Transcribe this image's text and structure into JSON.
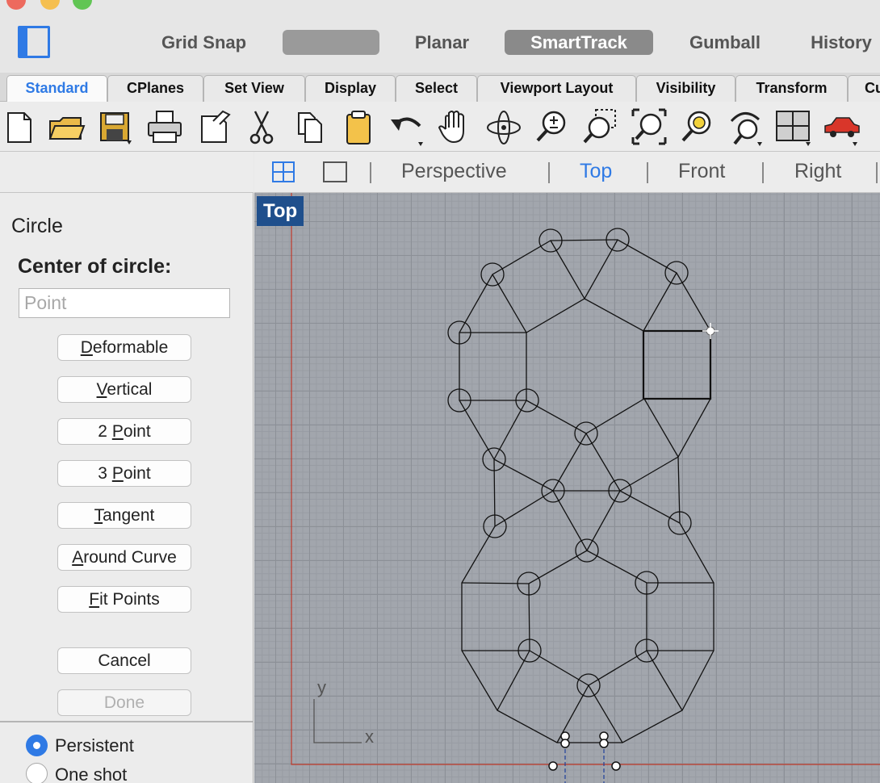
{
  "titlebar": {
    "buttons": [
      "Grid Snap",
      "",
      "Planar",
      "SmartTrack",
      "Gumball",
      "History"
    ]
  },
  "tabs": [
    {
      "label": "Standard",
      "active": true
    },
    {
      "label": "CPlanes"
    },
    {
      "label": "Set View"
    },
    {
      "label": "Display"
    },
    {
      "label": "Select"
    },
    {
      "label": "Viewport Layout"
    },
    {
      "label": "Visibility"
    },
    {
      "label": "Transform"
    },
    {
      "label": "Cu"
    }
  ],
  "toolbar_icons": [
    "new-file-icon",
    "open-folder-icon",
    "save-icon",
    "print-icon",
    "import-icon",
    "cut-icon",
    "copy-icon",
    "paste-icon",
    "undo-icon",
    "pan-hand-icon",
    "rotate-view-icon",
    "zoom-in-out-icon",
    "zoom-window-icon",
    "zoom-extents-icon",
    "zoom-selected-icon",
    "undo-view-icon",
    "four-viewports-icon",
    "render-car-icon"
  ],
  "command": {
    "title": "Circle",
    "prompt": "Center of circle:",
    "input_placeholder": "Point",
    "options": [
      {
        "label": "Deformable",
        "key": "D",
        "rest": "eformable"
      },
      {
        "label": "Vertical",
        "key": "V",
        "rest": "ertical"
      },
      {
        "label": "2 Point",
        "pre": "2 ",
        "key": "P",
        "rest": "oint"
      },
      {
        "label": "3 Point",
        "pre": "3 ",
        "key": "P",
        "rest": "oint"
      },
      {
        "label": "Tangent",
        "key": "T",
        "rest": "angent"
      },
      {
        "label": "Around Curve",
        "key": "A",
        "rest": "round Curve"
      },
      {
        "label": "Fit Points",
        "key": "F",
        "rest": "it Points"
      }
    ],
    "cancel_label": "Cancel",
    "done_label": "Done",
    "modes": [
      {
        "label": "Persistent",
        "checked": true
      },
      {
        "label": "One shot",
        "checked": false
      }
    ]
  },
  "viewport_tabs": [
    {
      "label": "Perspective"
    },
    {
      "label": "Top",
      "active": true
    },
    {
      "label": "Front"
    },
    {
      "label": "Right"
    }
  ],
  "viewport": {
    "label": "Top",
    "axis_y": "y",
    "axis_x": "x"
  },
  "colors": {
    "accent": "#2f7ae5",
    "viewport_bg": "#a2a6ad",
    "viewport_label_bg": "#1f4f8c",
    "boundary": "#c0392b"
  }
}
